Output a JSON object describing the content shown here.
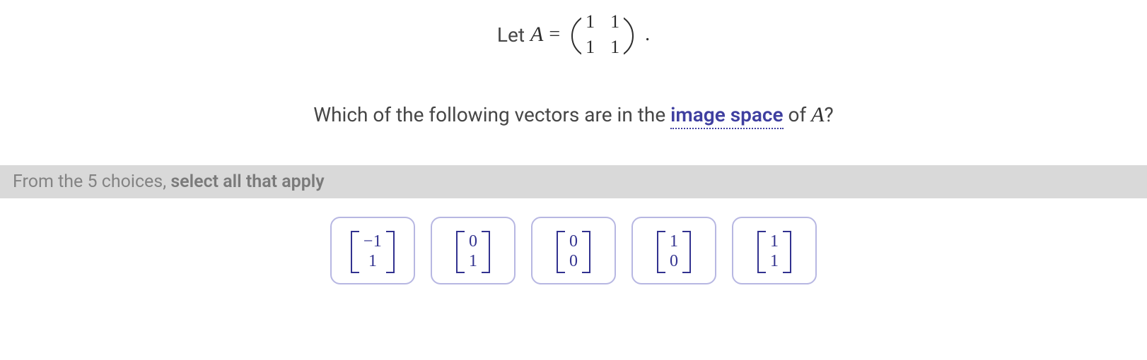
{
  "statement": {
    "let": "Let",
    "A": "A",
    "equals": "=",
    "matrix": [
      [
        "1",
        "1"
      ],
      [
        "1",
        "1"
      ]
    ],
    "period": "."
  },
  "question": {
    "prefix": "Which of the following vectors are in the ",
    "term": "image space",
    "suffix_of": " of ",
    "A": "A",
    "qmark": "?"
  },
  "instruction": {
    "prefix": "From the 5 choices, ",
    "bold": "select all that apply"
  },
  "choices": [
    {
      "top": "−1",
      "bot": "1"
    },
    {
      "top": "0",
      "bot": "1"
    },
    {
      "top": "0",
      "bot": "0"
    },
    {
      "top": "1",
      "bot": "0"
    },
    {
      "top": "1",
      "bot": "1"
    }
  ]
}
